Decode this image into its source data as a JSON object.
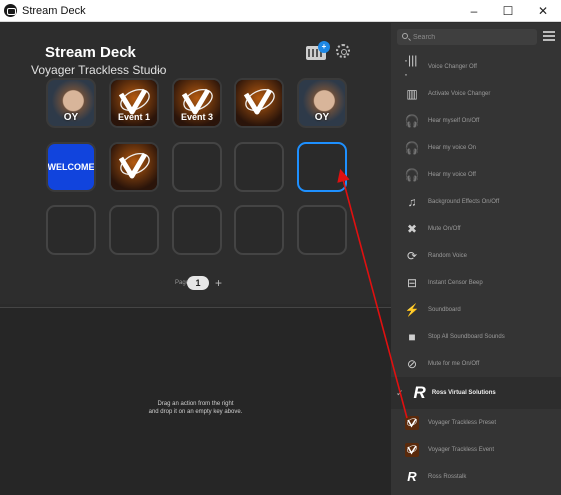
{
  "window": {
    "title": "Stream Deck",
    "minimize": "–",
    "maximize": "☐",
    "close": "✕"
  },
  "deck": {
    "title": "Stream Deck",
    "profile": "Voyager Trackless Studio",
    "store_badge": "+"
  },
  "keys": [
    {
      "type": "photo",
      "label": "OY"
    },
    {
      "type": "logo",
      "label": "Event 1"
    },
    {
      "type": "logo",
      "label": "Event 3"
    },
    {
      "type": "logo",
      "label": ""
    },
    {
      "type": "photo",
      "label": "OY"
    },
    {
      "type": "welcome",
      "label": "WELCOME"
    },
    {
      "type": "logo",
      "label": ""
    },
    {
      "type": "empty",
      "label": ""
    },
    {
      "type": "empty",
      "label": ""
    },
    {
      "type": "selected",
      "label": ""
    },
    {
      "type": "empty",
      "label": ""
    },
    {
      "type": "empty",
      "label": ""
    },
    {
      "type": "empty",
      "label": ""
    },
    {
      "type": "empty",
      "label": ""
    },
    {
      "type": "empty",
      "label": ""
    }
  ],
  "pages": {
    "label": "Pages",
    "current": "1",
    "add": "+"
  },
  "drop_hint": {
    "line1": "Drag an action from the right",
    "line2": "and drop it on an empty key above."
  },
  "sidebar": {
    "search_placeholder": "Search",
    "actions": [
      {
        "icon": "voice-changer-off-icon",
        "glyph": "·|||·",
        "label": "Voice Changer Off"
      },
      {
        "icon": "activate-voice-changer-icon",
        "glyph": "▥",
        "label": "Activate Voice Changer"
      },
      {
        "icon": "headphones-icon",
        "glyph": "🎧",
        "label": "Hear myself On/Off"
      },
      {
        "icon": "headphones-on-icon",
        "glyph": "🎧",
        "label": "Hear my voice On"
      },
      {
        "icon": "headphones-off-icon",
        "glyph": "🎧",
        "label": "Hear my voice Off"
      },
      {
        "icon": "music-note-icon",
        "glyph": "♫",
        "label": "Background Effects On/Off"
      },
      {
        "icon": "mute-icon",
        "glyph": "✖",
        "label": "Mute On/Off"
      },
      {
        "icon": "random-voice-icon",
        "glyph": "⟳",
        "label": "Random Voice"
      },
      {
        "icon": "censor-beep-icon",
        "glyph": "⊟",
        "label": "Instant Censor Beep"
      },
      {
        "icon": "soundboard-icon",
        "glyph": "⚡",
        "label": "Soundboard"
      },
      {
        "icon": "stop-icon",
        "glyph": "■",
        "label": "Stop All Soundboard Sounds"
      },
      {
        "icon": "mute-for-me-icon",
        "glyph": "⊘",
        "label": "Mute for me On/Off"
      }
    ],
    "group": {
      "logo": "R",
      "label": "Ross Virtual Solutions",
      "chevron": "✓",
      "actions": [
        {
          "icon": "voyager-preset-icon",
          "label": "Voyager Trackless Preset"
        },
        {
          "icon": "voyager-event-icon",
          "label": "Voyager Trackless Event"
        },
        {
          "icon": "ross-rosstalk-icon",
          "glyph": "R",
          "label": "Ross Rosstalk"
        }
      ]
    }
  },
  "colors": {
    "selected_key": "#1e90ff",
    "arrow": "#e01010",
    "welcome_key": "#1144dd",
    "store_badge": "#1e88e5"
  }
}
